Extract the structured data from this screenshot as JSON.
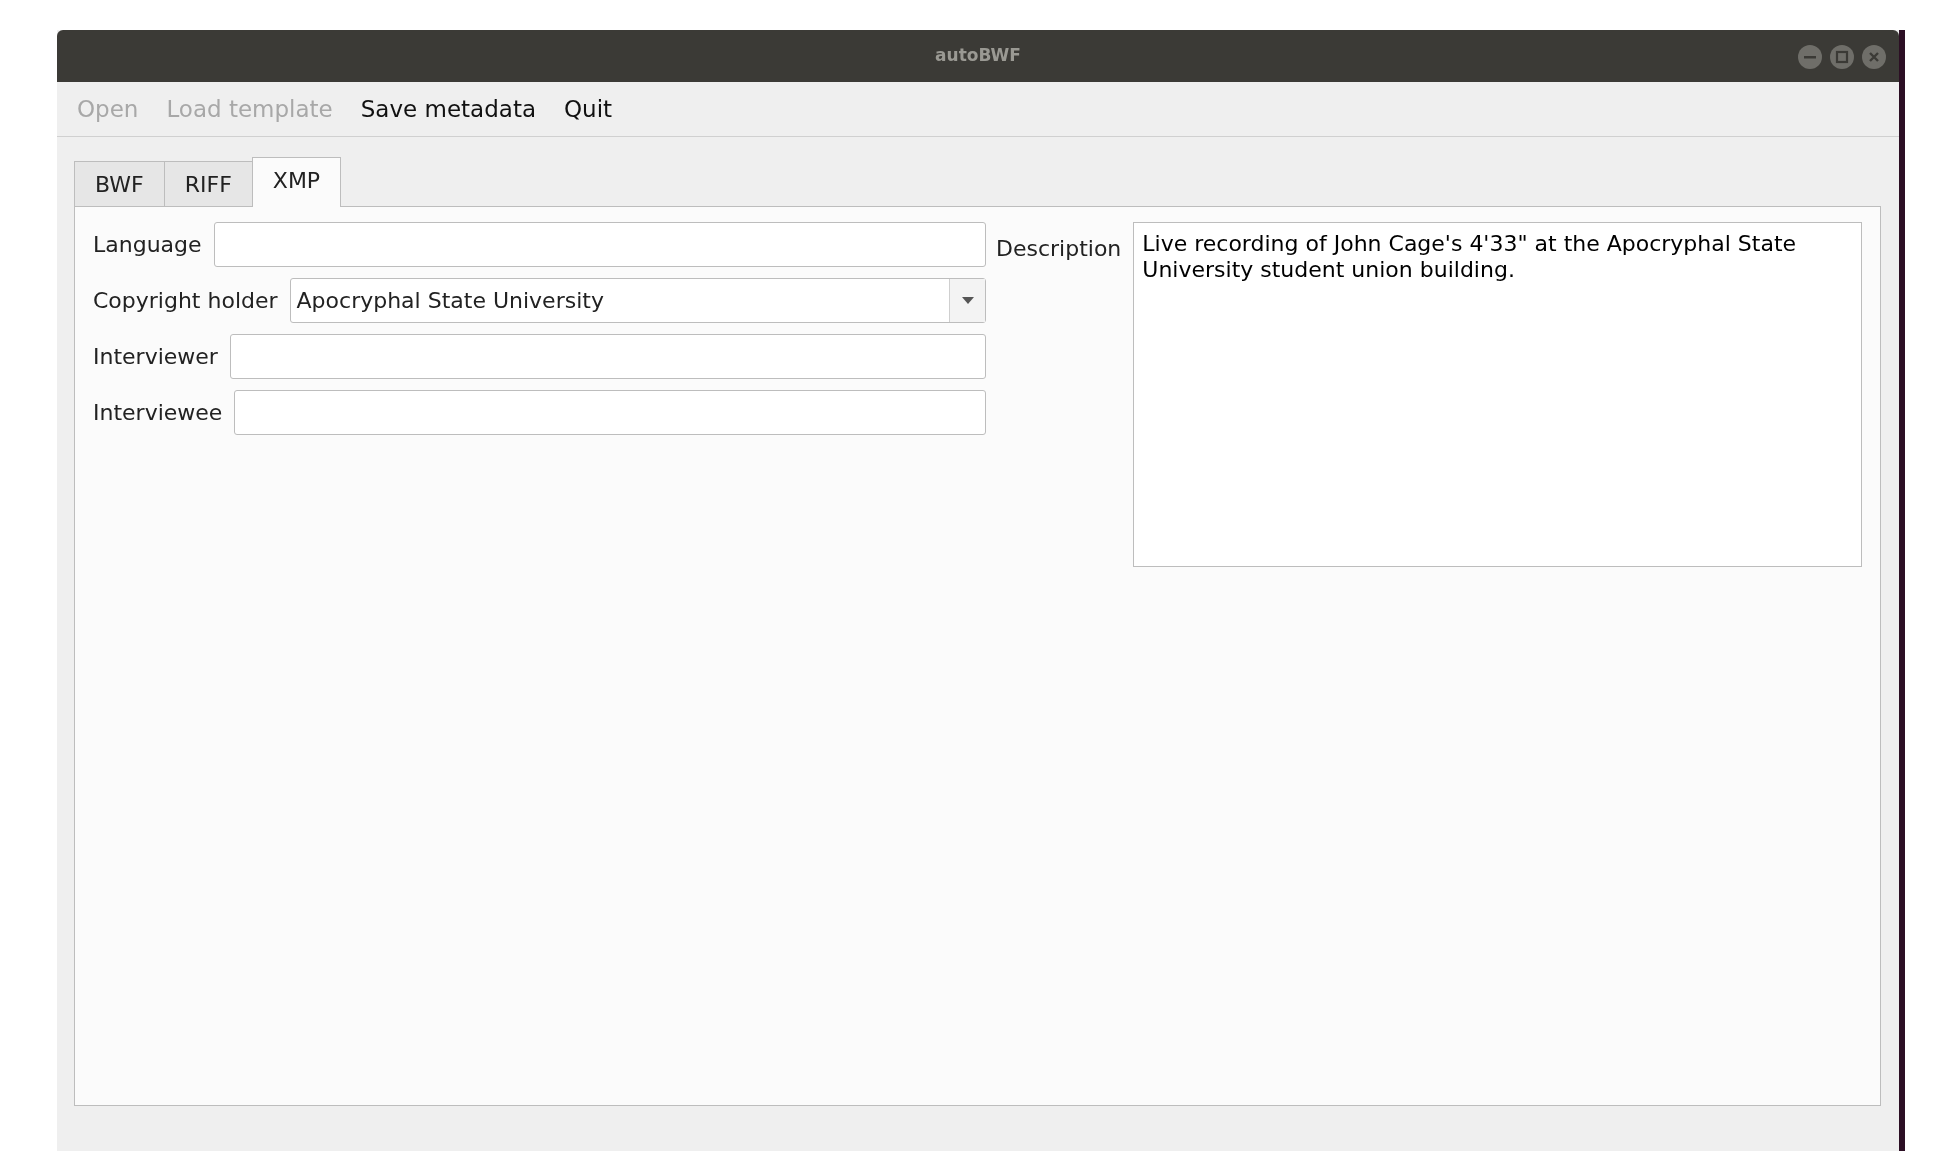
{
  "window": {
    "title": "autoBWF"
  },
  "menu": [
    {
      "label": "Open",
      "disabled": true
    },
    {
      "label": "Load template",
      "disabled": true
    },
    {
      "label": "Save metadata",
      "disabled": false
    },
    {
      "label": "Quit",
      "disabled": false
    }
  ],
  "tabs": [
    {
      "label": "BWF",
      "selected": false
    },
    {
      "label": "RIFF",
      "selected": false
    },
    {
      "label": "XMP",
      "selected": true
    }
  ],
  "fields": [
    {
      "label": "Language",
      "kind": "text"
    },
    {
      "label": "Copyright holder",
      "kind": "combo",
      "value": "Apocryphal State University"
    },
    {
      "label": "Interviewer",
      "kind": "text"
    },
    {
      "label": "Interviewee",
      "kind": "text"
    }
  ],
  "description": {
    "label": "Description",
    "value": "Live recording of John Cage's 4'33\" at the Apocryphal State University student union building."
  }
}
